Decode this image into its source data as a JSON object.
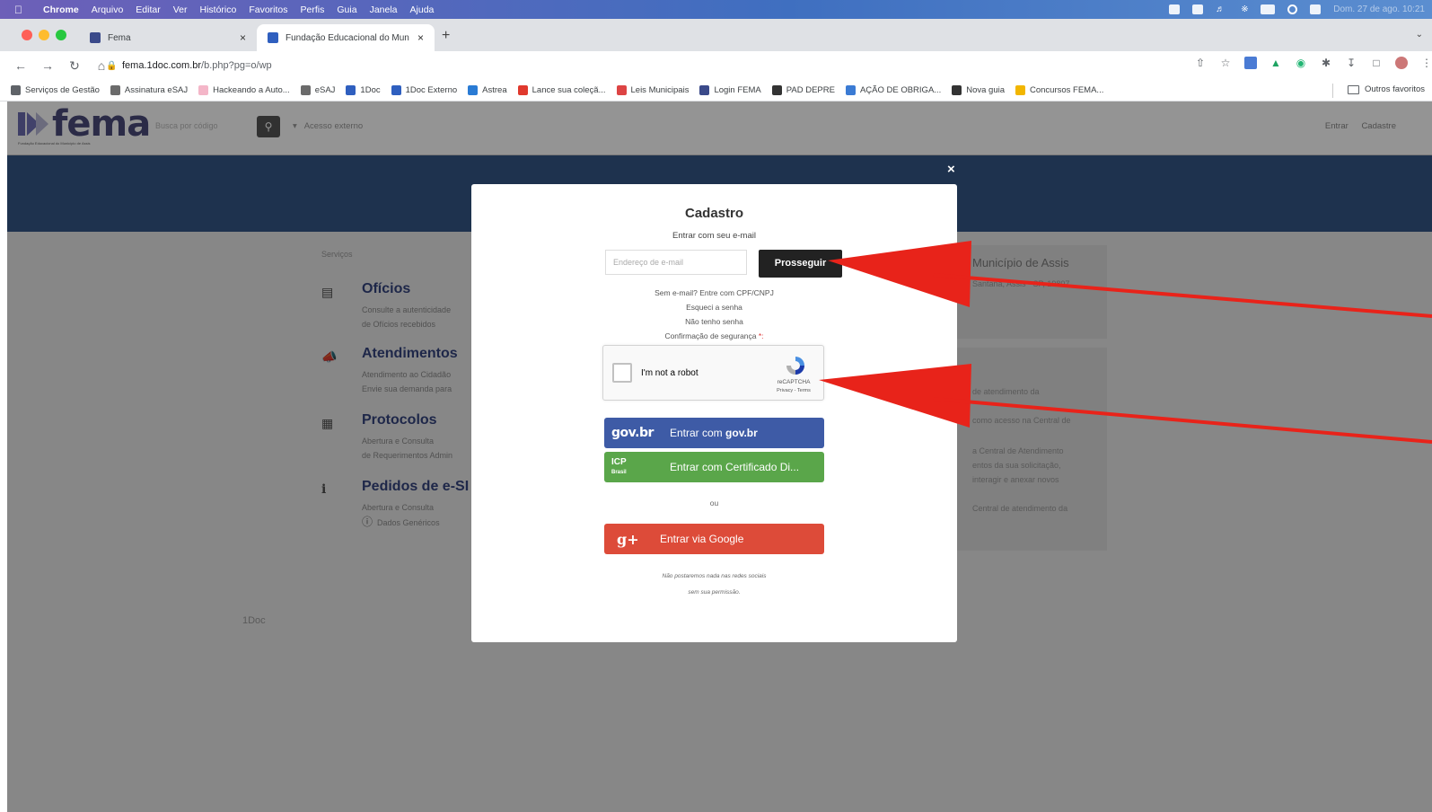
{
  "menubar": {
    "items": [
      "Chrome",
      "Arquivo",
      "Editar",
      "Ver",
      "Histórico",
      "Favoritos",
      "Perfis",
      "Guia",
      "Janela",
      "Ajuda"
    ],
    "datetime": "Dom. 27 de ago. 10:21"
  },
  "tabs": [
    {
      "title": "Fema",
      "color": "#3b4a8a"
    },
    {
      "title": "Fundação Educacional do Mun",
      "color": "#2f5fbf"
    }
  ],
  "address": {
    "host": "fema.1doc.com.br",
    "path": "/b.php?pg=o/wp"
  },
  "bookmarks": [
    {
      "label": "Serviços de Gestão",
      "icon": "folder-icon",
      "color": "#5f6368"
    },
    {
      "label": "Assinatura eSAJ",
      "icon": "esaj-icon",
      "color": "#6b6b6b"
    },
    {
      "label": "Hackeando a Auto...",
      "icon": "globe-icon",
      "color": "#f4b6c8"
    },
    {
      "label": "eSAJ",
      "icon": "esaj-icon",
      "color": "#6b6b6b"
    },
    {
      "label": "1Doc",
      "icon": "1doc-icon",
      "color": "#2f5fbf"
    },
    {
      "label": "1Doc Externo",
      "icon": "1doc-icon",
      "color": "#2f5fbf"
    },
    {
      "label": "Astrea",
      "icon": "astrea-icon",
      "color": "#2a7bd4"
    },
    {
      "label": "Lance sua coleçã...",
      "icon": "lance-icon",
      "color": "#e0392d"
    },
    {
      "label": "Leis Municipais",
      "icon": "leis-icon",
      "color": "#d44"
    },
    {
      "label": "Login FEMA",
      "icon": "fema-icon",
      "color": "#3b4a8a"
    },
    {
      "label": "PAD DEPRE",
      "icon": "globe-icon",
      "color": "#333"
    },
    {
      "label": "AÇÃO DE OBRIGA...",
      "icon": "acao-icon",
      "color": "#3b7bd4"
    },
    {
      "label": "Nova guia",
      "icon": "globe-icon",
      "color": "#333"
    },
    {
      "label": "Concursos FEMA...",
      "icon": "drive-icon",
      "color": "#f2b600"
    }
  ],
  "bookmarks_other": "Outros favoritos",
  "site": {
    "logo_word": "fema",
    "logo_sub": "Fundação Educacional do Município de Assis",
    "search_placeholder": "Busca por código",
    "external_access": "Acesso externo",
    "login": "Entrar",
    "register": "Cadastre",
    "services_label": "Serviços",
    "services": [
      {
        "name": "Ofícios",
        "icon": "document-icon",
        "desc": [
          "Consulte a autenticidade",
          "de Ofícios recebidos"
        ]
      },
      {
        "name": "Atendimentos",
        "icon": "megaphone-icon",
        "desc": [
          "Atendimento ao Cidadão",
          "Envie sua demanda para"
        ]
      },
      {
        "name": "Protocolos",
        "icon": "protocol-icon",
        "desc": [
          "Abertura e Consulta",
          "de Requerimentos Admin"
        ]
      },
      {
        "name": "Pedidos de e-SI",
        "icon": "info-icon",
        "desc": [
          "Abertura e Consulta"
        ]
      }
    ],
    "dados_genericos": "Dados Genéricos",
    "side_title": "Município de Assis",
    "side_address": "Santana, Assis - SP, 19807",
    "side_lines": [
      "de atendimento da",
      "como acesso na Central de",
      "a Central de Atendimento",
      "entos da sua solicitação,",
      "interagir e anexar novos",
      "Central de atendimento da"
    ],
    "footer": "1Doc"
  },
  "modal": {
    "close": "×",
    "title": "Cadastro",
    "subtitle": "Entrar com seu e-mail",
    "email_placeholder": "Endereço de e-mail",
    "proceed": "Prosseguir",
    "links": [
      "Sem e-mail? Entre com CPF/CNPJ",
      "Esqueci a senha",
      "Não tenho senha"
    ],
    "security_label": "Confirmação de segurança",
    "required_mark": "*:",
    "captcha_label": "I'm not a robot",
    "captcha_brand": "reCAPTCHA",
    "captcha_terms": "Privacy - Terms",
    "govbr_logo": "gov.br",
    "govbr_label": "Entrar com",
    "govbr_label_brand": "gov.br",
    "cert_logo_top": "ICP",
    "cert_logo_bottom": "Brasil",
    "cert_label": "Entrar com Certificado Di...",
    "or": "ou",
    "google_logo": "g+",
    "google_label": "Entrar via Google",
    "note_1": "Não postaremos nada nas redes sociais",
    "note_2": "sem sua permissão."
  },
  "colors": {
    "overlay": "rgba(0,0,0,0.47)",
    "govbr": "#3e5ba6",
    "cert": "#5aa64a",
    "google": "#dd4b39",
    "proceed": "#222222",
    "arrow": "#e8231a"
  }
}
